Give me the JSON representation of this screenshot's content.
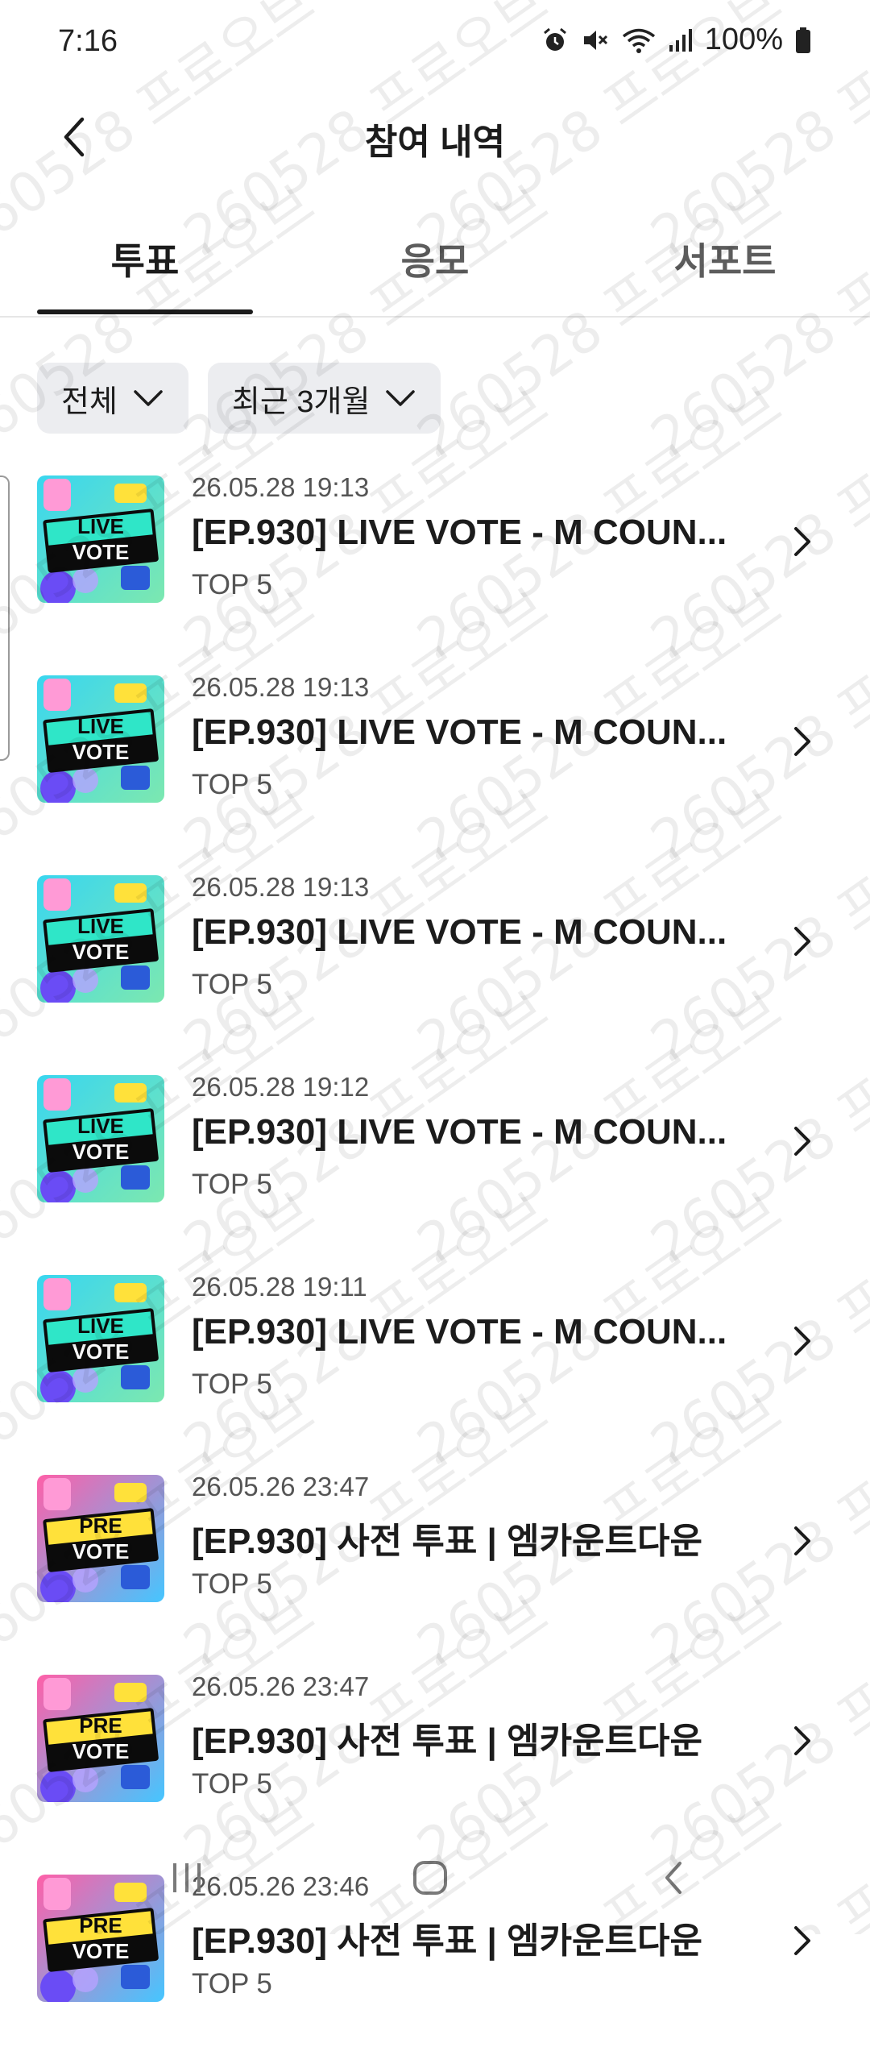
{
  "status_bar": {
    "time": "7:16",
    "battery": "100%",
    "icons": [
      "alarm-icon",
      "mute-icon",
      "wifi-icon",
      "signal-icon",
      "battery-icon"
    ]
  },
  "header": {
    "title": "참여 내역",
    "back_icon": "back-arrow-icon"
  },
  "tabs": [
    {
      "label": "투표",
      "active": true
    },
    {
      "label": "응모",
      "active": false
    },
    {
      "label": "서포트",
      "active": false
    }
  ],
  "filters": {
    "type": {
      "label": "전체"
    },
    "period": {
      "label": "최근 3개월"
    }
  },
  "items": [
    {
      "date": "26.05.28 19:13",
      "title": "[EP.930] LIVE VOTE - M COUN...",
      "sub": "TOP 5",
      "thumb": "live-vote",
      "thumb_text": [
        "LIVE",
        "VOTE"
      ]
    },
    {
      "date": "26.05.28 19:13",
      "title": "[EP.930] LIVE VOTE - M COUN...",
      "sub": "TOP 5",
      "thumb": "live-vote",
      "thumb_text": [
        "LIVE",
        "VOTE"
      ]
    },
    {
      "date": "26.05.28 19:13",
      "title": "[EP.930] LIVE VOTE - M COUN...",
      "sub": "TOP 5",
      "thumb": "live-vote",
      "thumb_text": [
        "LIVE",
        "VOTE"
      ]
    },
    {
      "date": "26.05.28 19:12",
      "title": "[EP.930] LIVE VOTE - M COUN...",
      "sub": "TOP 5",
      "thumb": "live-vote",
      "thumb_text": [
        "LIVE",
        "VOTE"
      ]
    },
    {
      "date": "26.05.28 19:11",
      "title": "[EP.930] LIVE VOTE - M COUN...",
      "sub": "TOP 5",
      "thumb": "live-vote",
      "thumb_text": [
        "LIVE",
        "VOTE"
      ]
    },
    {
      "date": "26.05.26 23:47",
      "title": "[EP.930] 사전 투표 | 엠카운트다운",
      "sub": "TOP 5",
      "thumb": "pre-vote",
      "thumb_text": [
        "PRE",
        "VOTE"
      ]
    },
    {
      "date": "26.05.26 23:47",
      "title": "[EP.930] 사전 투표 | 엠카운트다운",
      "sub": "TOP 5",
      "thumb": "pre-vote",
      "thumb_text": [
        "PRE",
        "VOTE"
      ]
    },
    {
      "date": "26.05.26 23:46",
      "title": "[EP.930] 사전 투표 | 엠카운트다운",
      "sub": "TOP 5",
      "thumb": "pre-vote",
      "thumb_text": [
        "PRE",
        "VOTE"
      ]
    }
  ],
  "watermark_text": "260528 프로오브",
  "colors": {
    "text_primary": "#1c1c1c",
    "text_secondary": "#555555",
    "chip_bg": "#ecedf0",
    "divider": "#e6e6e6"
  }
}
